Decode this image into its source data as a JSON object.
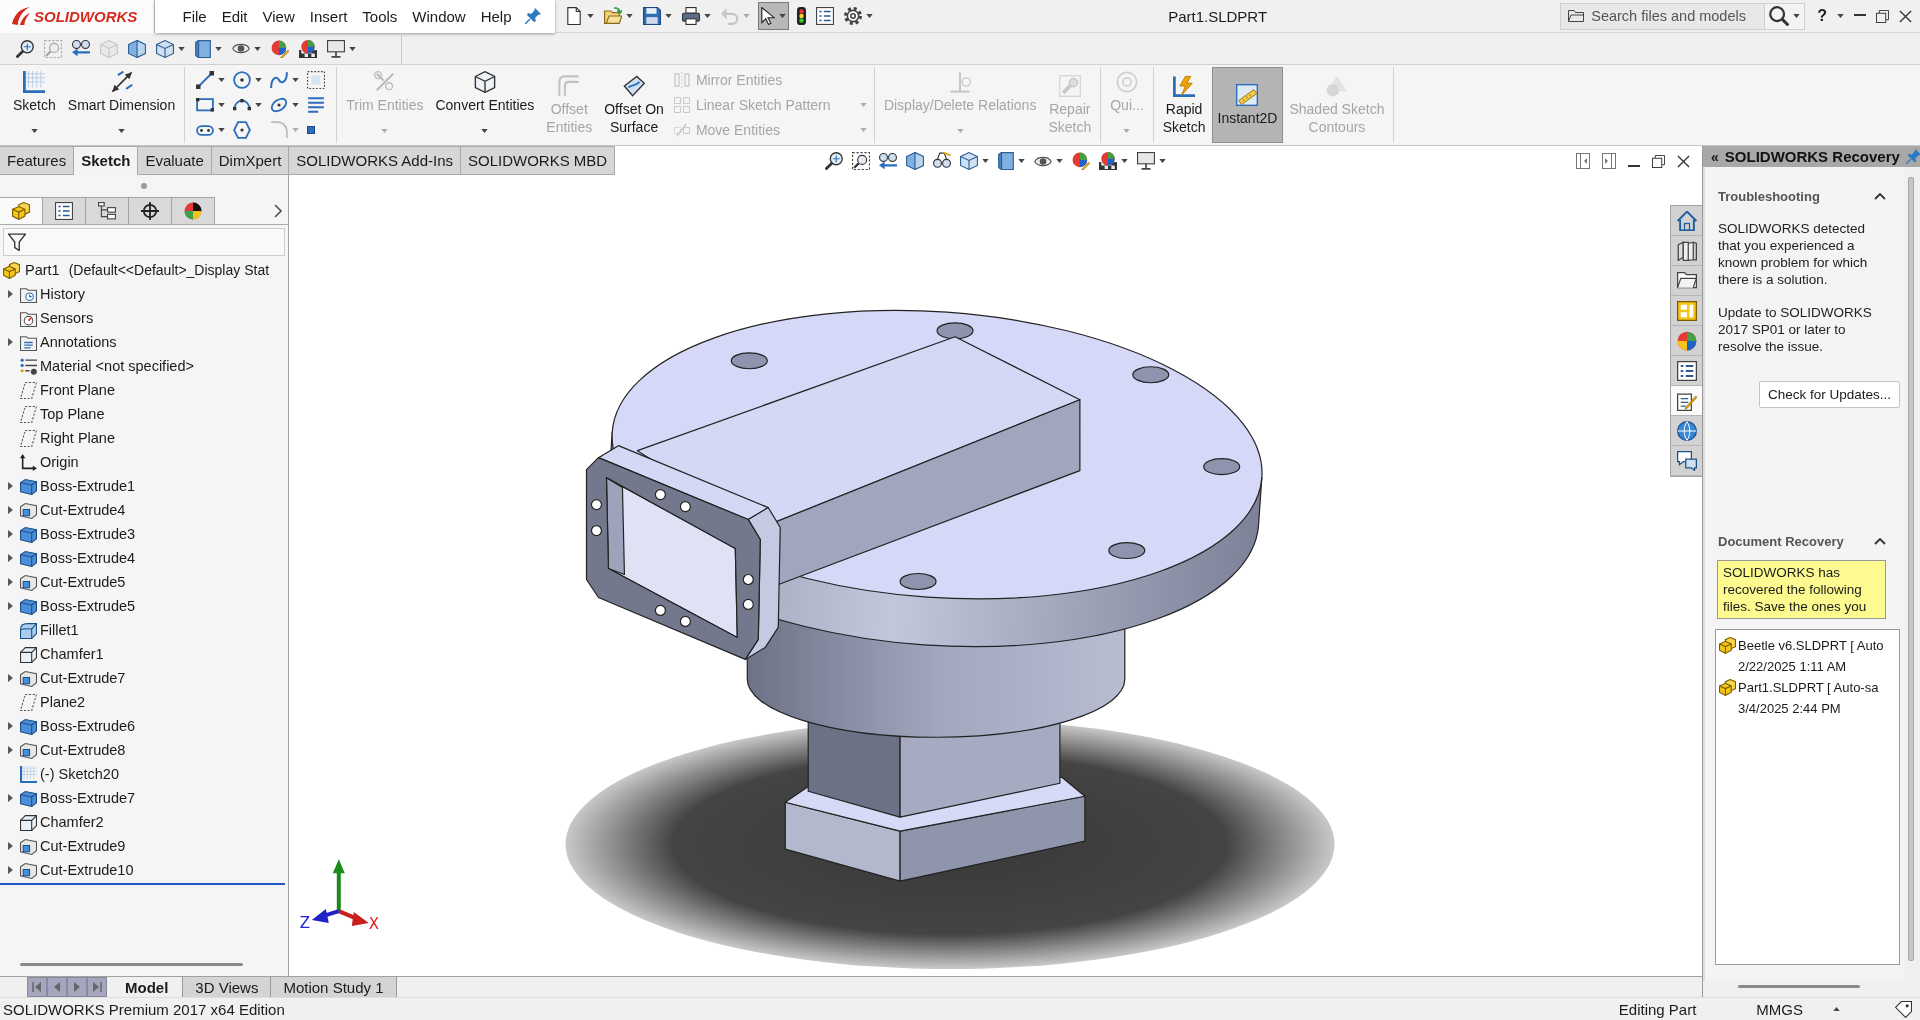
{
  "app": {
    "logo": "SOLIDWORKS",
    "title": "Part1.SLDPRT",
    "help": "?"
  },
  "menu": [
    "File",
    "Edit",
    "View",
    "Insert",
    "Tools",
    "Window",
    "Help"
  ],
  "quick_access": [
    {
      "kind": "new",
      "dropdown": true,
      "pressed": false,
      "disabled": false
    },
    {
      "kind": "open",
      "dropdown": true,
      "pressed": false,
      "disabled": false
    },
    {
      "kind": "save",
      "dropdown": true,
      "pressed": false,
      "disabled": false
    },
    {
      "kind": "print",
      "dropdown": true,
      "pressed": false,
      "disabled": false
    },
    {
      "kind": "undo",
      "dropdown": true,
      "pressed": false,
      "disabled": true
    },
    {
      "kind": "select",
      "dropdown": true,
      "pressed": true,
      "disabled": false
    },
    {
      "kind": "rebuild",
      "dropdown": false,
      "pressed": false,
      "disabled": false
    },
    {
      "kind": "file-properties",
      "dropdown": false,
      "pressed": false,
      "disabled": false
    },
    {
      "kind": "options",
      "dropdown": true,
      "pressed": false,
      "disabled": false
    }
  ],
  "search": {
    "placeholder": "Search files and models"
  },
  "view_toolbar": [
    {
      "kind": "zoom-fit",
      "dropdown": false,
      "disabled": false
    },
    {
      "kind": "zoom-area",
      "dropdown": false,
      "disabled": true
    },
    {
      "kind": "previous-view",
      "dropdown": false,
      "disabled": false
    },
    {
      "kind": "drawing-view",
      "dropdown": false,
      "disabled": true
    },
    {
      "kind": "section-view",
      "dropdown": false,
      "disabled": false
    },
    {
      "kind": "view-orientation",
      "dropdown": true,
      "disabled": false
    },
    {
      "kind": "display-style",
      "dropdown": true,
      "disabled": false
    },
    {
      "kind": "hide-show",
      "dropdown": true,
      "disabled": false
    },
    {
      "kind": "edit-appearance",
      "dropdown": false,
      "disabled": false
    },
    {
      "kind": "apply-scene",
      "dropdown": false,
      "disabled": false
    },
    {
      "kind": "view-settings",
      "dropdown": true,
      "disabled": false
    }
  ],
  "command_manager": {
    "groups": [
      [
        {
          "kind": "sketch",
          "label": "Sketch",
          "dropdown": true,
          "disabled": false,
          "pressed": false
        },
        {
          "kind": "smart-dimension",
          "label": "Smart Dimension",
          "dropdown": true,
          "disabled": false,
          "pressed": false
        }
      ],
      [
        {
          "tools": [
            {
              "kind": "line",
              "dropdown": true,
              "disabled": false
            },
            {
              "kind": "circle",
              "dropdown": true,
              "disabled": false
            },
            {
              "kind": "spline",
              "dropdown": true,
              "disabled": false
            },
            {
              "kind": "construction",
              "dropdown": false,
              "disabled": false
            },
            {
              "kind": "rectangle",
              "dropdown": true,
              "disabled": false
            },
            {
              "kind": "arc",
              "dropdown": true,
              "disabled": false
            },
            {
              "kind": "ellipse",
              "dropdown": true,
              "disabled": false
            },
            {
              "kind": "text",
              "dropdown": false,
              "disabled": false
            },
            {
              "kind": "slot",
              "dropdown": true,
              "disabled": false
            },
            {
              "kind": "polygon",
              "dropdown": false,
              "disabled": false
            },
            {
              "kind": "sketch-fillet",
              "dropdown": true,
              "disabled": true
            },
            {
              "kind": "point",
              "dropdown": false,
              "disabled": false
            }
          ]
        }
      ],
      [
        {
          "kind": "trim",
          "label": "Trim Entities",
          "dropdown": true,
          "disabled": true,
          "pressed": false
        },
        {
          "kind": "convert",
          "label": "Convert Entities",
          "dropdown": true,
          "disabled": false,
          "pressed": false
        },
        {
          "kind": "offset",
          "label": "Offset Entities",
          "dropdown": false,
          "disabled": true,
          "pressed": false
        },
        {
          "kind": "offset-surface",
          "label": "Offset On Surface",
          "dropdown": false,
          "disabled": false,
          "pressed": false
        },
        {
          "items": [
            {
              "kind": "mirror",
              "label": "Mirror Entities",
              "dropdown": false,
              "disabled": true
            },
            {
              "kind": "linear-pattern",
              "label": "Linear Sketch Pattern",
              "dropdown": true,
              "disabled": true
            },
            {
              "kind": "move",
              "label": "Move Entities",
              "dropdown": true,
              "disabled": true
            }
          ]
        }
      ],
      [
        {
          "kind": "relations",
          "label": "Display/Delete Relations",
          "dropdown": true,
          "disabled": true,
          "pressed": false
        },
        {
          "kind": "repair",
          "label": "Repair Sketch",
          "dropdown": false,
          "disabled": true,
          "pressed": false
        }
      ],
      [
        {
          "kind": "quick-snaps",
          "label": "Qui...",
          "dropdown": true,
          "disabled": true,
          "pressed": false
        }
      ],
      [
        {
          "kind": "rapid-sketch",
          "label": "Rapid Sketch",
          "dropdown": false,
          "disabled": false,
          "pressed": false
        },
        {
          "kind": "instant2d",
          "label": "Instant2D",
          "dropdown": false,
          "disabled": false,
          "pressed": true
        },
        {
          "kind": "shaded-contours",
          "label": "Shaded Sketch Contours",
          "dropdown": false,
          "disabled": true,
          "pressed": false
        }
      ]
    ],
    "tabs": [
      {
        "label": "Features",
        "selected": false
      },
      {
        "label": "Sketch",
        "selected": true
      },
      {
        "label": "Evaluate",
        "selected": false
      },
      {
        "label": "DimXpert",
        "selected": false
      },
      {
        "label": "SOLIDWORKS Add-Ins",
        "selected": false
      },
      {
        "label": "SOLIDWORKS MBD",
        "selected": false
      }
    ]
  },
  "feature_manager": {
    "tabs": [
      {
        "kind": "feature-tree",
        "selected": true
      },
      {
        "kind": "property-manager",
        "selected": false
      },
      {
        "kind": "configuration-manager",
        "selected": false
      },
      {
        "kind": "dimxpert-manager",
        "selected": false
      },
      {
        "kind": "display-manager",
        "selected": false
      }
    ],
    "tree": {
      "label": "Part1",
      "configuration": "(Default<<Default>_Display Stat",
      "children": [
        {
          "label": "History",
          "kind": "history",
          "expanded": false
        },
        {
          "label": "Sensors",
          "kind": "sensors"
        },
        {
          "label": "Annotations",
          "kind": "annotations",
          "expanded": false
        },
        {
          "label": "Material <not specified>",
          "kind": "material"
        },
        {
          "label": "Front Plane",
          "kind": "plane"
        },
        {
          "label": "Top Plane",
          "kind": "plane"
        },
        {
          "label": "Right Plane",
          "kind": "plane"
        },
        {
          "label": "Origin",
          "kind": "origin"
        },
        {
          "label": "Boss-Extrude1",
          "kind": "boss",
          "expanded": false
        },
        {
          "label": "Cut-Extrude4",
          "kind": "cut",
          "expanded": false
        },
        {
          "label": "Boss-Extrude3",
          "kind": "boss",
          "expanded": false
        },
        {
          "label": "Boss-Extrude4",
          "kind": "boss",
          "expanded": false
        },
        {
          "label": "Cut-Extrude5",
          "kind": "cut",
          "expanded": false
        },
        {
          "label": "Boss-Extrude5",
          "kind": "boss",
          "expanded": false
        },
        {
          "label": "Fillet1",
          "kind": "fillet"
        },
        {
          "label": "Chamfer1",
          "kind": "chamfer"
        },
        {
          "label": "Cut-Extrude7",
          "kind": "cut",
          "expanded": false
        },
        {
          "label": "Plane2",
          "kind": "plane"
        },
        {
          "label": "Boss-Extrude6",
          "kind": "boss",
          "expanded": false
        },
        {
          "label": "Cut-Extrude8",
          "kind": "cut",
          "expanded": false
        },
        {
          "label": "(-) Sketch20",
          "kind": "sketch"
        },
        {
          "label": "Boss-Extrude7",
          "kind": "boss",
          "expanded": false
        },
        {
          "label": "Chamfer2",
          "kind": "chamfer"
        },
        {
          "label": "Cut-Extrude9",
          "kind": "cut",
          "expanded": false
        },
        {
          "label": "Cut-Extrude10",
          "kind": "cut",
          "expanded": false
        }
      ]
    }
  },
  "graphics": {
    "heads_up": [
      {
        "kind": "zoom-fit",
        "dropdown": false
      },
      {
        "kind": "zoom-area",
        "dropdown": false
      },
      {
        "kind": "previous-view",
        "dropdown": false
      },
      {
        "kind": "section-view",
        "dropdown": false
      },
      {
        "kind": "dynamic-annotation",
        "dropdown": false
      },
      {
        "kind": "view-orientation",
        "dropdown": true
      },
      {
        "kind": "display-style",
        "dropdown": true
      },
      {
        "kind": "hide-show",
        "dropdown": true
      },
      {
        "kind": "edit-appearance",
        "dropdown": false
      },
      {
        "kind": "apply-scene",
        "dropdown": true
      },
      {
        "kind": "view-settings",
        "dropdown": true
      }
    ],
    "triad": {
      "x_label": "X",
      "z_label": "Z"
    }
  },
  "task_tabs": [
    {
      "kind": "home",
      "selected": false
    },
    {
      "kind": "library",
      "selected": false
    },
    {
      "kind": "folder",
      "selected": false
    },
    {
      "kind": "view-palette",
      "selected": false
    },
    {
      "kind": "appearance",
      "selected": false
    },
    {
      "kind": "custom-properties",
      "selected": false
    },
    {
      "kind": "sketch-ink",
      "selected": true
    },
    {
      "kind": "forum",
      "selected": false
    },
    {
      "kind": "chat",
      "selected": false
    }
  ],
  "task_pane": {
    "collapse": "«",
    "title": "SOLIDWORKS Recovery",
    "sections": [
      {
        "kind": "troubleshooting",
        "title": "Troubleshooting",
        "expanded": true,
        "paragraphs": [
          "SOLIDWORKS detected that you experienced a known problem for which there is a solution.",
          "Update to SOLIDWORKS 2017 SP01 or later to resolve the issue."
        ],
        "button": "Check for Updates..."
      },
      {
        "kind": "recovery",
        "title": "Document Recovery",
        "expanded": true,
        "note": "SOLIDWORKS has recovered the following files. Save the ones you",
        "files": [
          {
            "name": "Beetle v6.SLDPRT [ Auto",
            "time": "2/22/2025 1:11 AM"
          },
          {
            "name": "Part1.SLDPRT [ Auto-sa",
            "time": "3/4/2025 2:44 PM"
          }
        ]
      }
    ]
  },
  "model_tabs": [
    {
      "label": "Model",
      "selected": true
    },
    {
      "label": "3D Views",
      "selected": false
    },
    {
      "label": "Motion Study 1",
      "selected": false
    }
  ],
  "status_bar": {
    "edition": "SOLIDWORKS Premium 2017 x64 Edition",
    "mode": "Editing Part",
    "units": "MMGS"
  }
}
